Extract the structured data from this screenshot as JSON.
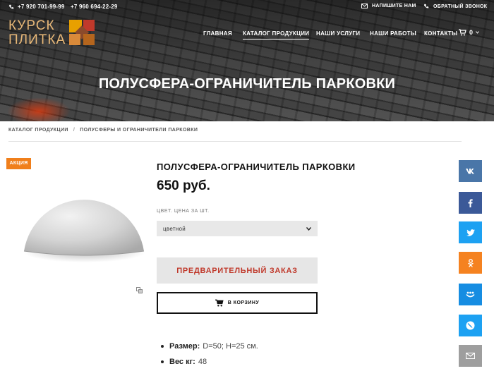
{
  "header": {
    "phones": [
      "+7 920 701-99-99",
      "+7 960 694-22-29"
    ],
    "write_label": "НАПИШИТЕ НАМ",
    "callback_label": "ОБРАТНЫЙ ЗВОНОК",
    "logo_line1": "КУРСК",
    "logo_line2": "ПЛИТКА",
    "nav": [
      "ГЛАВНАЯ",
      "КАТАЛОГ ПРОДУКЦИИ",
      "НАШИ УСЛУГИ",
      "НАШИ РАБОТЫ",
      "КОНТАКТЫ"
    ],
    "active_nav": "КАТАЛОГ ПРОДУКЦИИ",
    "cart_count": "0"
  },
  "page_title": "ПОЛУСФЕРА-ОГРАНИЧИТЕЛЬ ПАРКОВКИ",
  "breadcrumbs": [
    "КАТАЛОГ ПРОДУКЦИИ",
    "ПОЛУСФЕРЫ И ОГРАНИЧИТЕЛИ ПАРКОВКИ"
  ],
  "breadcrumb_separator": "/",
  "product": {
    "badge": "АКЦИЯ",
    "title": "ПОЛУСФЕРА-ОГРАНИЧИТЕЛЬ ПАРКОВКИ",
    "price": "650 руб.",
    "option_label": "ЦВЕТ. ЦЕНА ЗА ШТ.",
    "option_selected": "цветной",
    "preorder_label": "ПРЕДВАРИТЕЛЬНЫЙ ЗАКАЗ",
    "cart_label": "В КОРЗИНУ",
    "specs": [
      {
        "label": "Размер:",
        "value": "D=50; H=25 см."
      },
      {
        "label": "Вес кг:",
        "value": "48"
      }
    ]
  },
  "share_buttons": [
    {
      "name": "vk",
      "glyph": "vk",
      "color": "#4a76a8"
    },
    {
      "name": "facebook",
      "glyph": "f",
      "color": "#3b5998"
    },
    {
      "name": "twitter",
      "glyph": "bird",
      "color": "#1da1f2"
    },
    {
      "name": "odnoklassniki",
      "glyph": "ok",
      "color": "#f58220"
    },
    {
      "name": "moimir",
      "glyph": "mm",
      "color": "#168de2"
    },
    {
      "name": "livejournal",
      "glyph": "lj",
      "color": "#1da1f2"
    },
    {
      "name": "email",
      "glyph": "mail",
      "color": "#9e9e9e"
    }
  ],
  "colors": {
    "accent_orange": "#f07f1b",
    "preorder_text": "#c0392b",
    "logo": "#e8b878"
  }
}
